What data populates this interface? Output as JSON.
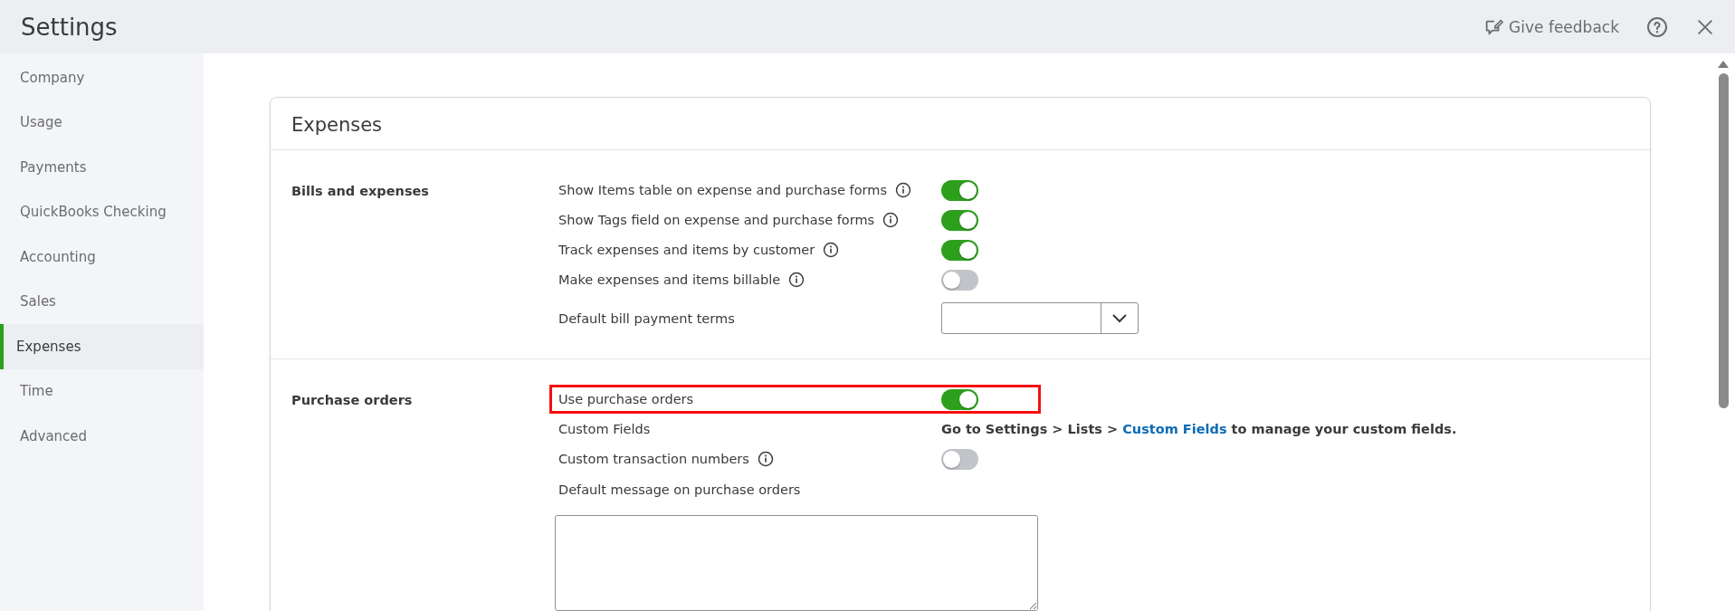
{
  "window": {
    "title": "Settings"
  },
  "header_actions": {
    "feedback": "Give feedback"
  },
  "sidebar": {
    "items": [
      {
        "label": "Company",
        "selected": false
      },
      {
        "label": "Usage",
        "selected": false
      },
      {
        "label": "Payments",
        "selected": false
      },
      {
        "label": "QuickBooks Checking",
        "selected": false
      },
      {
        "label": "Accounting",
        "selected": false
      },
      {
        "label": "Sales",
        "selected": false
      },
      {
        "label": "Expenses",
        "selected": true
      },
      {
        "label": "Time",
        "selected": false
      },
      {
        "label": "Advanced",
        "selected": false
      }
    ]
  },
  "card": {
    "title": "Expenses",
    "sections": [
      {
        "title": "Bills and expenses",
        "rows": [
          {
            "kind": "toggle",
            "label": "Show Items table on expense and purchase forms",
            "info": true,
            "on": true,
            "highlighted": false
          },
          {
            "kind": "toggle",
            "label": "Show Tags field on expense and purchase forms",
            "info": true,
            "on": true,
            "highlighted": false
          },
          {
            "kind": "toggle",
            "label": "Track expenses and items by customer",
            "info": true,
            "on": true,
            "highlighted": false
          },
          {
            "kind": "toggle",
            "label": "Make expenses and items billable",
            "info": true,
            "on": false,
            "highlighted": false
          },
          {
            "kind": "select",
            "label": "Default bill payment terms",
            "info": false,
            "highlighted": false
          }
        ]
      },
      {
        "title": "Purchase orders",
        "rows": [
          {
            "kind": "toggle",
            "label": "Use purchase orders",
            "info": false,
            "on": true,
            "highlighted": true
          },
          {
            "kind": "note",
            "label": "Custom Fields",
            "info": false,
            "highlighted": false,
            "text_before": "Go to Settings > Lists > ",
            "link": "Custom Fields",
            "text_after": " to manage your custom fields."
          },
          {
            "kind": "toggle",
            "label": "Custom transaction numbers",
            "info": true,
            "on": false,
            "highlighted": false
          },
          {
            "kind": "textarea",
            "label": "Default message on purchase orders",
            "info": false,
            "highlighted": false
          }
        ]
      }
    ]
  }
}
